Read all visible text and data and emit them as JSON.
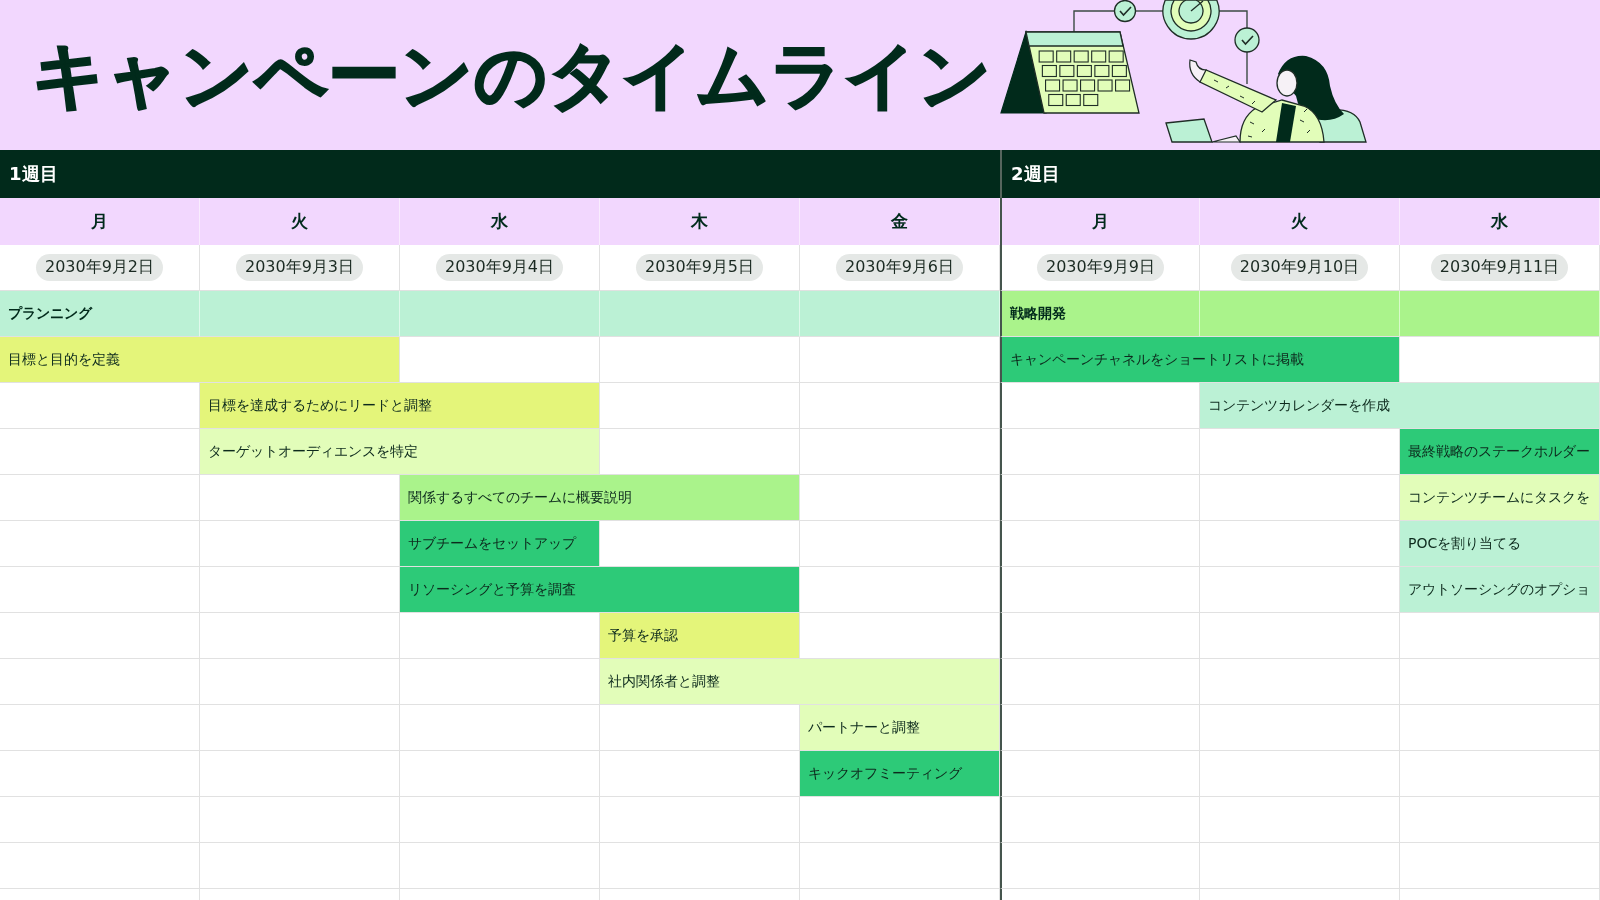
{
  "title": "キャンペーンのタイムライン",
  "weeks": [
    {
      "label": "1週目",
      "days": [
        {
          "day": "月",
          "date": "2030年9月2日"
        },
        {
          "day": "火",
          "date": "2030年9月3日"
        },
        {
          "day": "水",
          "date": "2030年9月4日"
        },
        {
          "day": "木",
          "date": "2030年9月5日"
        },
        {
          "day": "金",
          "date": "2030年9月6日"
        }
      ]
    },
    {
      "label": "2週目",
      "days": [
        {
          "day": "月",
          "date": "2030年9月9日"
        },
        {
          "day": "火",
          "date": "2030年9月10日"
        },
        {
          "day": "水",
          "date": "2030年9月11日"
        }
      ]
    }
  ],
  "rows": [
    {
      "kind": "phase",
      "cells": [
        {
          "kind": "bar",
          "color": "#bbf1d5",
          "text": "プランニング"
        },
        {
          "kind": "bar",
          "color": "#bbf1d5"
        },
        {
          "kind": "bar",
          "color": "#bbf1d5"
        },
        {
          "kind": "bar",
          "color": "#bbf1d5"
        },
        {
          "kind": "bar",
          "color": "#bbf1d5"
        },
        {
          "kind": "bar",
          "color": "#aaf38b",
          "text": "戦略開発"
        },
        {
          "kind": "bar",
          "color": "#aaf38b"
        },
        {
          "kind": "bar",
          "color": "#aaf38b"
        }
      ]
    },
    {
      "kind": "task",
      "cells": [
        {
          "kind": "bar",
          "color": "#e4f57a",
          "text": "目標と目的を定義"
        },
        {
          "kind": "bar",
          "color": "#e4f57a"
        },
        {
          "kind": "blank"
        },
        {
          "kind": "blank"
        },
        {
          "kind": "blank"
        },
        {
          "kind": "bar",
          "color": "#2dca78",
          "text": "キャンペーンチャネルをショートリストに掲載"
        },
        {
          "kind": "bar",
          "color": "#2dca78"
        },
        {
          "kind": "blank"
        }
      ]
    },
    {
      "kind": "task",
      "cells": [
        {
          "kind": "blank"
        },
        {
          "kind": "bar",
          "color": "#e4f57a",
          "text": "目標を達成するためにリードと調整"
        },
        {
          "kind": "bar",
          "color": "#e4f57a"
        },
        {
          "kind": "blank"
        },
        {
          "kind": "blank"
        },
        {
          "kind": "blank"
        },
        {
          "kind": "bar",
          "color": "#bbf1d5",
          "text": "コンテンツカレンダーを作成"
        },
        {
          "kind": "bar",
          "color": "#bbf1d5"
        }
      ]
    },
    {
      "kind": "task",
      "cells": [
        {
          "kind": "blank"
        },
        {
          "kind": "bar",
          "color": "#e2fdb9",
          "text": "ターゲットオーディエンスを特定"
        },
        {
          "kind": "bar",
          "color": "#e2fdb9"
        },
        {
          "kind": "blank"
        },
        {
          "kind": "blank"
        },
        {
          "kind": "blank"
        },
        {
          "kind": "blank"
        },
        {
          "kind": "bar",
          "color": "#2dca78",
          "text": "最終戦略のステークホルダー"
        }
      ]
    },
    {
      "kind": "task",
      "cells": [
        {
          "kind": "blank"
        },
        {
          "kind": "blank"
        },
        {
          "kind": "bar",
          "color": "#aaf38b",
          "text": "関係するすべてのチームに概要説明"
        },
        {
          "kind": "bar",
          "color": "#aaf38b"
        },
        {
          "kind": "blank"
        },
        {
          "kind": "blank"
        },
        {
          "kind": "blank"
        },
        {
          "kind": "bar",
          "color": "#e2fdb9",
          "text": "コンテンツチームにタスクを"
        }
      ]
    },
    {
      "kind": "task",
      "cells": [
        {
          "kind": "blank"
        },
        {
          "kind": "blank"
        },
        {
          "kind": "bar",
          "color": "#2dca78",
          "text": "サブチームをセットアップ"
        },
        {
          "kind": "blank"
        },
        {
          "kind": "blank"
        },
        {
          "kind": "blank"
        },
        {
          "kind": "blank"
        },
        {
          "kind": "bar",
          "color": "#bbf1d5",
          "text": "POCを割り当てる"
        }
      ]
    },
    {
      "kind": "task",
      "cells": [
        {
          "kind": "blank"
        },
        {
          "kind": "blank"
        },
        {
          "kind": "bar",
          "color": "#2dca78",
          "text": "リソーシングと予算を調査"
        },
        {
          "kind": "bar",
          "color": "#2dca78"
        },
        {
          "kind": "blank"
        },
        {
          "kind": "blank"
        },
        {
          "kind": "blank"
        },
        {
          "kind": "bar",
          "color": "#bbf1d5",
          "text": "アウトソーシングのオプショ"
        }
      ]
    },
    {
      "kind": "task",
      "cells": [
        {
          "kind": "blank"
        },
        {
          "kind": "blank"
        },
        {
          "kind": "blank"
        },
        {
          "kind": "bar",
          "color": "#e4f57a",
          "text": "予算を承認"
        },
        {
          "kind": "blank"
        },
        {
          "kind": "blank"
        },
        {
          "kind": "blank"
        },
        {
          "kind": "blank"
        }
      ]
    },
    {
      "kind": "task",
      "cells": [
        {
          "kind": "blank"
        },
        {
          "kind": "blank"
        },
        {
          "kind": "blank"
        },
        {
          "kind": "bar",
          "color": "#e2fdb9",
          "text": "社内関係者と調整"
        },
        {
          "kind": "bar",
          "color": "#e2fdb9"
        },
        {
          "kind": "blank"
        },
        {
          "kind": "blank"
        },
        {
          "kind": "blank"
        }
      ]
    },
    {
      "kind": "task",
      "cells": [
        {
          "kind": "blank"
        },
        {
          "kind": "blank"
        },
        {
          "kind": "blank"
        },
        {
          "kind": "blank"
        },
        {
          "kind": "bar",
          "color": "#e2fdb9",
          "text": "パートナーと調整"
        },
        {
          "kind": "blank"
        },
        {
          "kind": "blank"
        },
        {
          "kind": "blank"
        }
      ]
    },
    {
      "kind": "task",
      "cells": [
        {
          "kind": "blank"
        },
        {
          "kind": "blank"
        },
        {
          "kind": "blank"
        },
        {
          "kind": "blank"
        },
        {
          "kind": "bar",
          "color": "#2dca78",
          "text": "キックオフミーティング"
        },
        {
          "kind": "blank"
        },
        {
          "kind": "blank"
        },
        {
          "kind": "blank"
        }
      ]
    },
    {
      "kind": "task",
      "cells": [
        {
          "kind": "blank"
        },
        {
          "kind": "blank"
        },
        {
          "kind": "blank"
        },
        {
          "kind": "blank"
        },
        {
          "kind": "blank"
        },
        {
          "kind": "blank"
        },
        {
          "kind": "blank"
        },
        {
          "kind": "blank"
        }
      ]
    },
    {
      "kind": "task",
      "cells": [
        {
          "kind": "blank"
        },
        {
          "kind": "blank"
        },
        {
          "kind": "blank"
        },
        {
          "kind": "blank"
        },
        {
          "kind": "blank"
        },
        {
          "kind": "blank"
        },
        {
          "kind": "blank"
        },
        {
          "kind": "blank"
        }
      ]
    },
    {
      "kind": "task",
      "cells": [
        {
          "kind": "blank"
        },
        {
          "kind": "blank"
        },
        {
          "kind": "blank"
        },
        {
          "kind": "blank"
        },
        {
          "kind": "blank"
        },
        {
          "kind": "blank"
        },
        {
          "kind": "blank"
        },
        {
          "kind": "blank"
        }
      ]
    }
  ]
}
